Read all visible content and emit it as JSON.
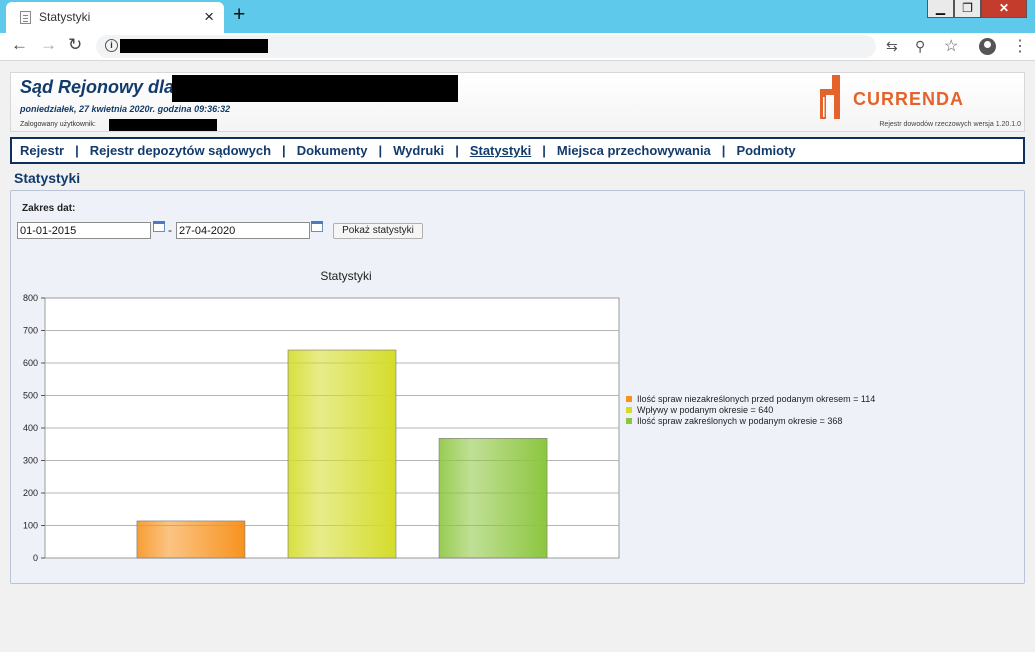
{
  "browser": {
    "tab_title": "Statystyki",
    "tab_close": "×",
    "new_tab": "+",
    "window_buttons": {
      "minimize": "▁",
      "restore": "❐",
      "close": "✕"
    },
    "nav": {
      "back": "←",
      "forward": "→",
      "reload": "↻"
    },
    "icons": {
      "translate": "⇆",
      "zoom": "⚲",
      "star": "☆",
      "menu": "⋮"
    }
  },
  "header": {
    "court_prefix": "Sąd Rejonowy dla",
    "datetime": "poniedziałek, 27 kwietnia 2020r. godzina 09:36:32",
    "user_label": "Zalogowany użytkownik:",
    "version": "Rejestr dowodów rzeczowych wersja 1.20.1.0",
    "logo_text": "CURRENDA"
  },
  "menu": {
    "items": [
      "Rejestr",
      "Rejestr depozytów sądowych",
      "Dokumenty",
      "Wydruki",
      "Statystyki",
      "Miejsca przechowywania",
      "Podmioty"
    ],
    "separator": "|",
    "active_index": 4
  },
  "page_title": "Statystyki",
  "filters": {
    "range_label": "Zakres dat:",
    "date_from": "01-01-2015",
    "date_to": "27-04-2020",
    "dash": "-",
    "show_button": "Pokaż statystyki"
  },
  "chart_data": {
    "type": "bar",
    "title": "Statystyki",
    "xlabel": "",
    "ylabel": "",
    "ylim": [
      0,
      800
    ],
    "yticks": [
      0,
      100,
      200,
      300,
      400,
      500,
      600,
      700,
      800
    ],
    "grid": true,
    "legend_position": "right",
    "series": [
      {
        "name": "Ilość spraw niezakreślonych przed podanym okresem = 114",
        "value": 114,
        "color": "#f7931e"
      },
      {
        "name": "Wpływy w podanym okresie = 640",
        "value": 640,
        "color": "#d4dc2a"
      },
      {
        "name": "Ilość spraw zakreślonych w podanym okresie = 368",
        "value": 368,
        "color": "#8cc63f"
      }
    ]
  }
}
